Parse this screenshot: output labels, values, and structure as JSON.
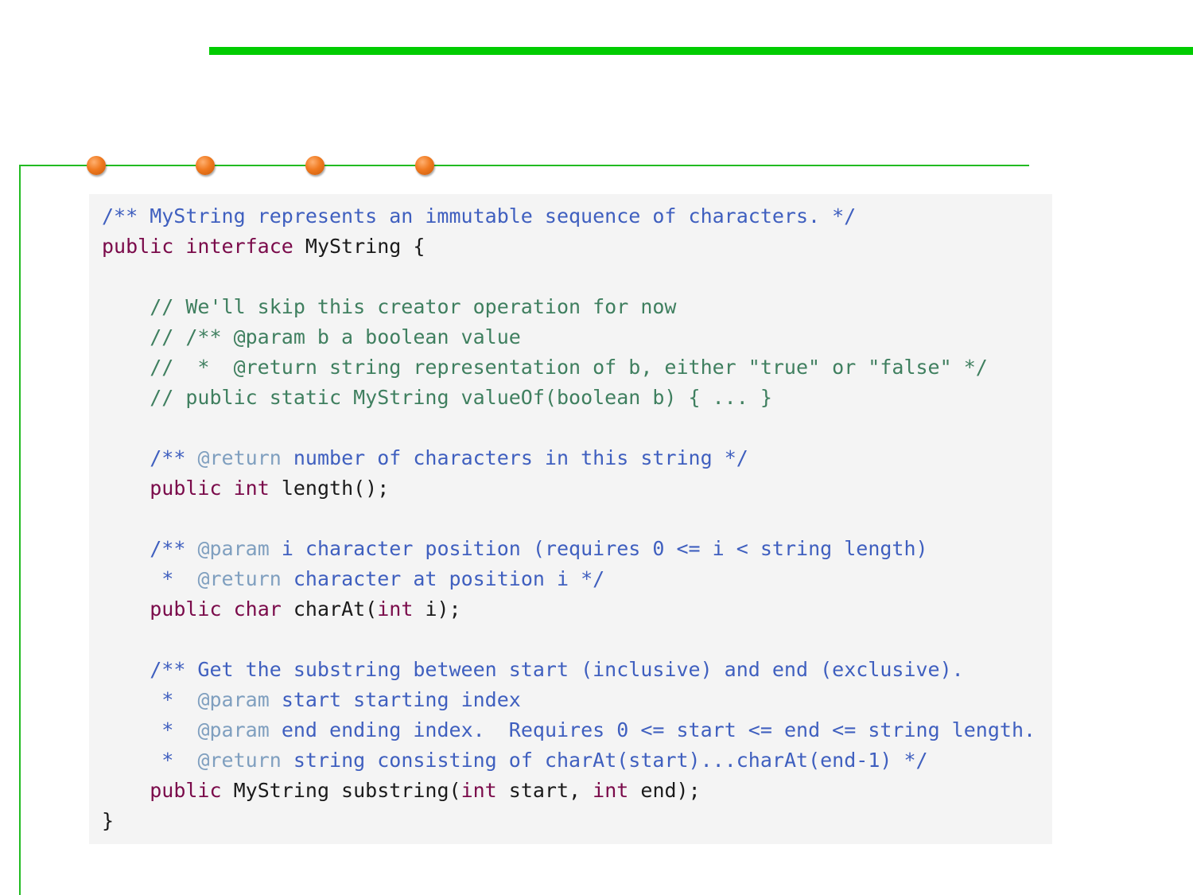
{
  "code": {
    "line1_doc": "/** MyString represents an immutable sequence of characters. */",
    "line2_kw1": "public",
    "line2_kw2": "interface",
    "line2_rest": "MyString {",
    "line4_comment": "// We'll skip this creator operation for now",
    "line5_comment": "// /** @param b a boolean value",
    "line6_comment": "//  *  @return string representation of b, either \"true\" or \"false\" */",
    "line7_comment": "// public static MyString valueOf(boolean b) { ... }",
    "line9_doc_start": "/**",
    "line9_tag": "@return",
    "line9_doc_rest": "number of characters in this string */",
    "line10_kw1": "public",
    "line10_kw2": "int",
    "line10_rest": "length();",
    "line12_doc_start": "/**",
    "line12_tag": "@param",
    "line12_doc_rest": "i character position (requires 0 <= i < string length)",
    "line13_star": " *",
    "line13_tag": "@return",
    "line13_doc_rest": "character at position i */",
    "line14_kw1": "public",
    "line14_kw2": "char",
    "line14_rest1": "charAt(",
    "line14_kw3": "int",
    "line14_rest2": "i);",
    "line16_doc": "/** Get the substring between start (inclusive) and end (exclusive).",
    "line17_star": " *",
    "line17_tag": "@param",
    "line17_doc_rest": "start starting index",
    "line18_star": " *",
    "line18_tag": "@param",
    "line18_doc_rest": "end ending index.  Requires 0 <= start <= end <= string length.",
    "line19_star": " *",
    "line19_tag": "@return",
    "line19_doc_rest": "string consisting of charAt(start)...charAt(end-1) */",
    "line20_kw1": "public",
    "line20_rest1": "MyString substring(",
    "line20_kw2": "int",
    "line20_rest2": "start,",
    "line20_kw3": "int",
    "line20_rest3": "end);",
    "line21_close": "}"
  },
  "colors": {
    "top_bar": "#00cc00",
    "frame": "#22bb22",
    "dots": "#f07a20",
    "keyword": "#7a0a4a",
    "javadoc": "#3f5fbf",
    "javadoc_tag": "#7f9fbf",
    "comment": "#3f7f5f",
    "code_background": "#f4f4f4"
  }
}
